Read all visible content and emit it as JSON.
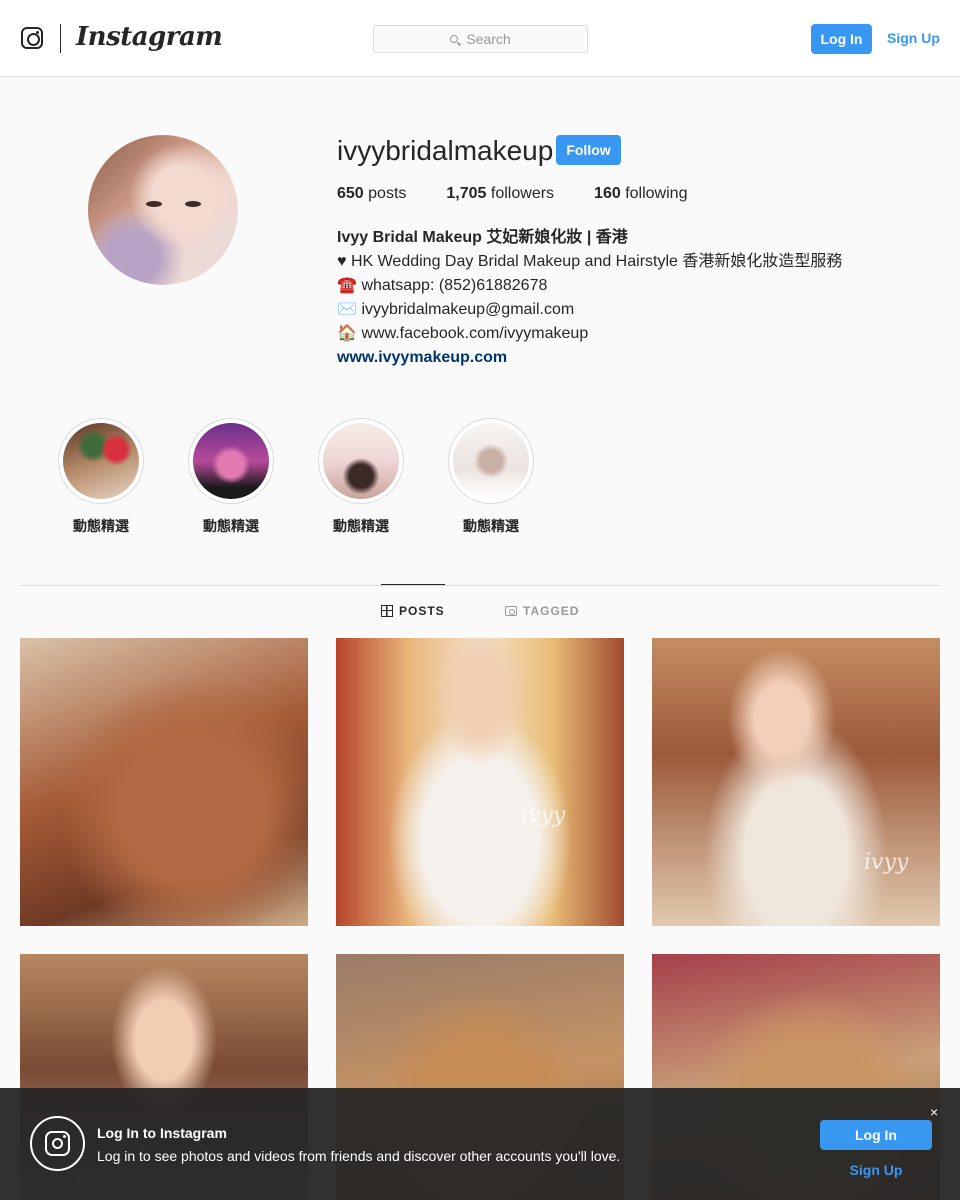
{
  "header": {
    "wordmark": "Instagram",
    "search_placeholder": "Search",
    "login_label": "Log In",
    "signup_label": "Sign Up"
  },
  "profile": {
    "username": "ivyybridalmakeup",
    "follow_label": "Follow",
    "stats": {
      "posts_count": "650",
      "posts_label": "posts",
      "followers_count": "1,705",
      "followers_label": "followers",
      "following_count": "160",
      "following_label": "following"
    },
    "bio": {
      "name": "Ivyy Bridal Makeup 艾妃新娘化妝 | 香港",
      "line1": "♥ HK Wedding Day Bridal Makeup and Hairstyle 香港新娘化妝造型服務",
      "line2_icon": "☎️",
      "line2": "whatsapp: (852)61882678",
      "line3_icon": "✉️",
      "line3": "ivyybridalmakeup@gmail.com",
      "line4_icon": "🏠",
      "line4": "www.facebook.com/ivyymakeup",
      "website": "www.ivyymakeup.com"
    }
  },
  "highlights": [
    {
      "label": "動態精選"
    },
    {
      "label": "動態精選"
    },
    {
      "label": "動態精選"
    },
    {
      "label": "動態精選"
    }
  ],
  "tabs": {
    "posts": "POSTS",
    "tagged": "TAGGED"
  },
  "posts": [
    {
      "watermark": ""
    },
    {
      "watermark": "ivyy"
    },
    {
      "watermark": "ivyy"
    },
    {
      "watermark": "ivyy"
    },
    {
      "watermark": ""
    },
    {
      "watermark": ""
    }
  ],
  "banner": {
    "title": "Log In to Instagram",
    "subtitle": "Log in to see photos and videos from friends and discover other accounts you'll love.",
    "close": "×",
    "login_label": "Log In",
    "signup_label": "Sign Up"
  },
  "colors": {
    "accent": "#3897f0",
    "link_dark": "#003569",
    "text": "#262626",
    "muted": "#999999",
    "background": "#fafafa"
  }
}
